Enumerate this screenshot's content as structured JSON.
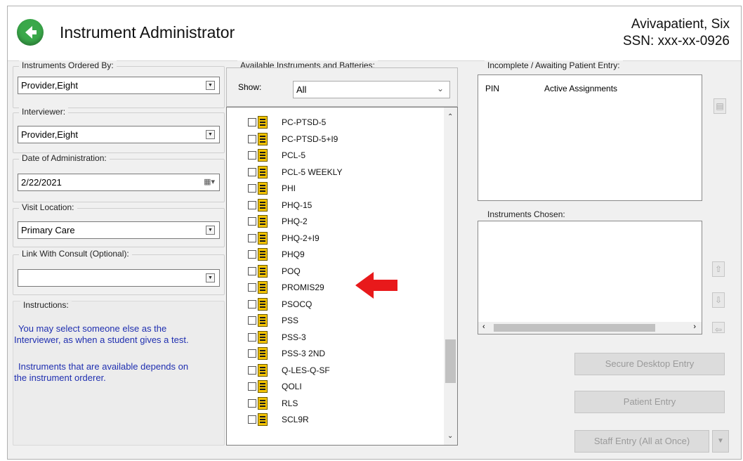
{
  "header": {
    "title": "Instrument Administrator",
    "patient_name": "Avivapatient, Six",
    "ssn": "SSN: xxx-xx-0926"
  },
  "left": {
    "ordered_by_label": "Instruments Ordered By:",
    "ordered_by_value": "Provider,Eight",
    "interviewer_label": "Interviewer:",
    "interviewer_value": "Provider,Eight",
    "date_label": "Date of Administration:",
    "date_value": "2/22/2021",
    "location_label": "Visit Location:",
    "location_value": "Primary Care",
    "consult_label": "Link With Consult (Optional):",
    "consult_value": "",
    "instructions_label": "Instructions:",
    "instr_1a": "You may select someone else as the",
    "instr_1b": "Interviewer, as when a student gives a test.",
    "instr_2a": "Instruments that are available depends on",
    "instr_2b": "the instrument orderer."
  },
  "available": {
    "label": "Available Instruments and Batteries:",
    "show_label": "Show:",
    "show_value": "All",
    "items": [
      "PC-PTSD-5",
      "PC-PTSD-5+I9",
      "PCL-5",
      "PCL-5 WEEKLY",
      "PHI",
      "PHQ-15",
      "PHQ-2",
      "PHQ-2+I9",
      "PHQ9",
      "POQ",
      "PROMIS29",
      "PSOCQ",
      "PSS",
      "PSS-3",
      "PSS-3 2ND",
      "Q-LES-Q-SF",
      "QOLI",
      "RLS",
      "SCL9R"
    ]
  },
  "incomplete": {
    "label": "Incomplete / Awaiting Patient Entry:",
    "col_pin": "PIN",
    "col_active": "Active Assignments"
  },
  "chosen": {
    "label": "Instruments Chosen:"
  },
  "buttons": {
    "secure": "Secure Desktop Entry",
    "patient": "Patient Entry",
    "staff": "Staff Entry (All at Once)"
  },
  "colors": {
    "arrow": "#e8191b",
    "link_text": "#1f2fb0",
    "back_icon": "#3aa84a"
  }
}
